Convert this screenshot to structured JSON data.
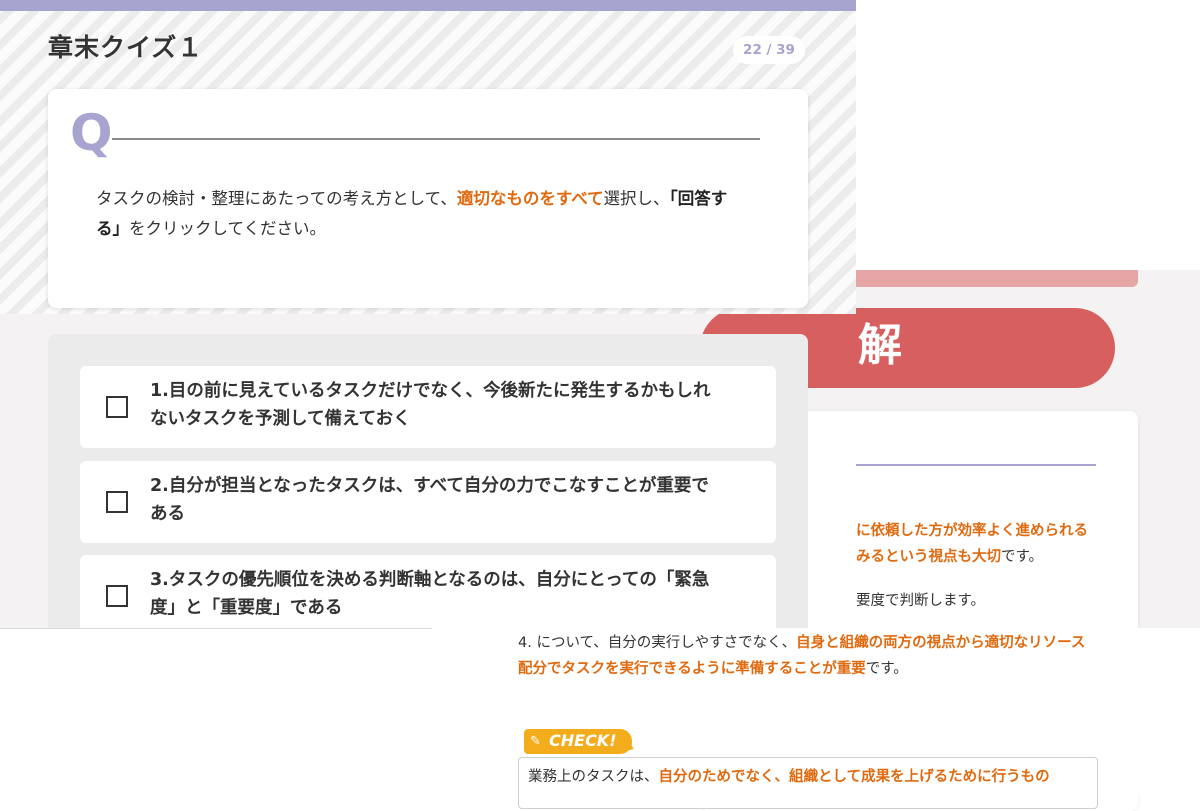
{
  "quiz": {
    "title": "章末クイズ１",
    "progress": "22 / 39",
    "question_letter": "Q",
    "question_line1_a": "タスクの検討・整理にあたっての考え方として、",
    "question_line1_hl": "適切なものをすべて",
    "question_line1_b": "選択し、",
    "question_line1_bold": "「回答す",
    "question_line2_bold": "る」",
    "question_line2_rest": "をクリックしてください。",
    "options": [
      {
        "line1": "1.目の前に見えているタスクだけでなく、今後新たに発生するかもしれ",
        "line2": "ないタスクを予測して備えておく"
      },
      {
        "line1": "2.自分が担当となったタスクは、すべて自分の力でこなすことが重要で",
        "line2": "ある"
      },
      {
        "line1": "3.タスクの優先順位を決める判断軸となるのは、自分にとっての「緊急",
        "line2": "度」と「重要度」である"
      }
    ]
  },
  "answer": {
    "heading_fragment": "解",
    "line1_hl": "に依頼した方が効率よく進められる",
    "line2_hl": "みるという視点も大切",
    "line2_rest": "です。",
    "line3": "要度で判断します。",
    "line4_a": "4. について、自分の実行しやすさでなく、",
    "line4_hl": "自身と組織の両方の視点から適切なリソース",
    "line5_hl": "配分でタスクを実行できるように準備することが重要",
    "line5_rest": "です。",
    "check_label": "CHECK!",
    "check_text_a": "業務上のタスクは、",
    "check_text_hl": "自分のためでなく、組織として成果を上げるために行うもの"
  },
  "icons": {
    "check_badge_icon": "pencil-icon",
    "checkbox_icon": "checkbox-empty-icon"
  },
  "colors": {
    "accent_purple": "#a8a4d0",
    "highlight_orange": "#e06a10",
    "answer_red": "#d75f5f",
    "check_yellow": "#f2ac1c"
  }
}
